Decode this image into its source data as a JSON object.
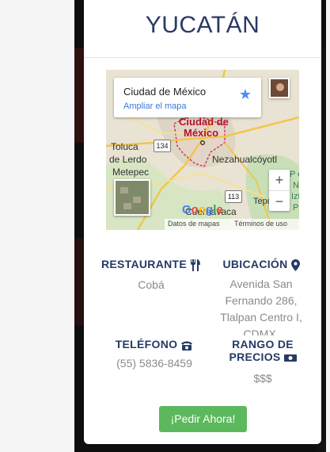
{
  "card": {
    "title": "YUCATÁN"
  },
  "map": {
    "info_title": "Ciudad de México",
    "info_link": "Ampliar el mapa",
    "labels": {
      "ciudad_de": "Ciudad de",
      "mexico": "México",
      "toluca": "Toluca",
      "de_lerdo": "de Lerdo",
      "metepec": "Metepec",
      "nezahualcoyotl": "Nezahualcóyotl",
      "cuernavaca": "Cuernavaca",
      "tepoz": "Tepoz",
      "parque_nac": "P e",
      "nacional": "Na",
      "iztacc": "Iztac",
      "popo": "Popo",
      "shield_134": "134",
      "shield_113": "113"
    },
    "zoom_in": "+",
    "zoom_out": "−",
    "google_logo": "Google",
    "map_data": "Datos de mapas",
    "terms": "Términos de uso"
  },
  "restaurant": {
    "label": "RESTAURANTE",
    "value": "Cobá"
  },
  "location": {
    "label": "UBICACIÓN",
    "lines": [
      "Avenida San",
      "Fernando 286,",
      "Tlalpan Centro I,",
      "CDMX."
    ]
  },
  "phone": {
    "label": "TELÉFONO",
    "value": "(55) 5836-8459"
  },
  "price": {
    "label_line1": "RANGO DE",
    "label_line2": "PRECIOS",
    "value": "$$$"
  },
  "order_button": "¡Pedir Ahora!",
  "colors": {
    "heading": "#253a66",
    "muted": "#8a8a8a",
    "button": "#5cb85c",
    "link": "#3a78d8"
  },
  "icons": {
    "restaurant": "utensils-icon",
    "location": "map-marker-icon",
    "phone": "phone-icon",
    "price": "money-icon"
  }
}
